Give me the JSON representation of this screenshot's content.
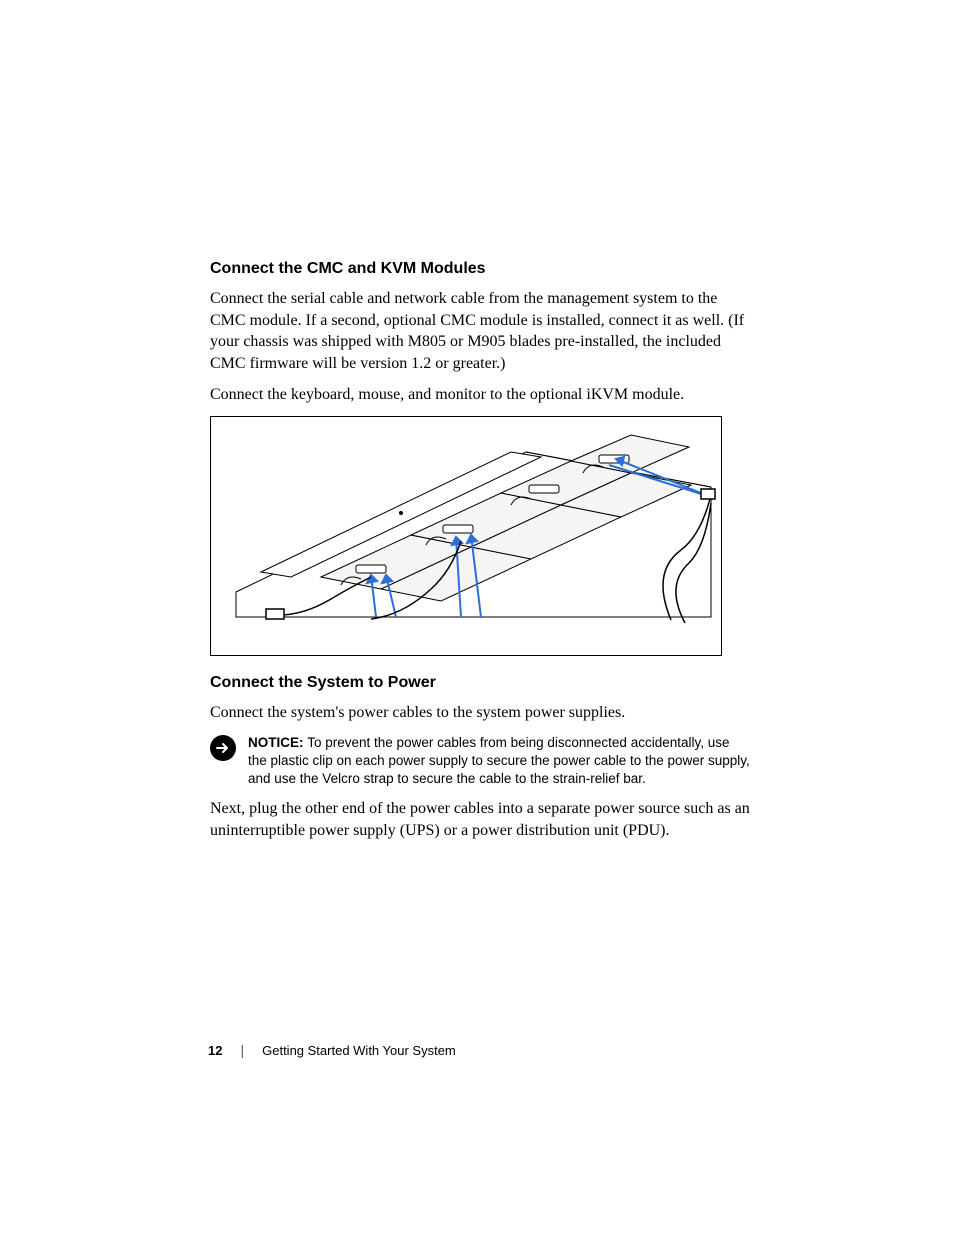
{
  "section1": {
    "heading": "Connect the CMC and KVM Modules",
    "para1": "Connect the serial cable and network cable from the management system to the CMC module. If a second, optional CMC module is installed, connect it as well. (If your chassis was shipped with M805 or M905 blades pre-installed, the included CMC firmware will be version 1.2 or greater.)",
    "para2": "Connect the keyboard, mouse, and monitor to the optional iKVM module."
  },
  "section2": {
    "heading": "Connect the System to Power",
    "para1": "Connect the system's power cables to the system power supplies.",
    "notice_label": "NOTICE: ",
    "notice_body": "To prevent the power cables from being disconnected accidentally, use the plastic clip on each power supply to secure the power cable to the power supply, and use the Velcro strap to secure the cable to the strain-relief bar.",
    "para2": "Next, plug the other end of the power cables into a separate power source such as an uninterruptible power supply (UPS) or a power distribution unit (PDU)."
  },
  "footer": {
    "page": "12",
    "chapter": "Getting Started With Your System"
  }
}
